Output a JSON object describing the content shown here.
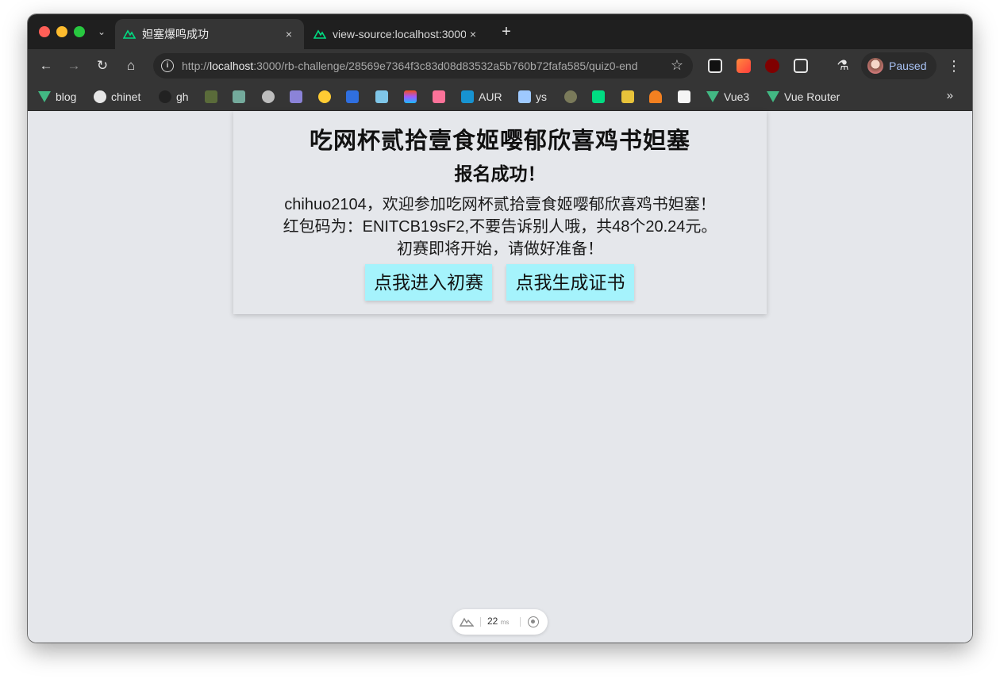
{
  "browser": {
    "tabs": [
      {
        "title": "妲塞爆鸣成功",
        "active": true
      },
      {
        "title": "view-source:localhost:3000",
        "active": false
      }
    ],
    "new_tab_label": "+",
    "close_label": "×",
    "url_scheme": "http://",
    "url_host": "localhost",
    "url_rest": ":3000/rb-challenge/28569e7364f3c83d08d83532a5b760b72fafa585/quiz0-end",
    "profile_status": "Paused",
    "bookmarks": [
      "blog",
      "chinet",
      "gh",
      "AUR",
      "ys",
      "Vue3",
      "Vue Router"
    ],
    "colors": {
      "nuxt_green": "#00dc82",
      "vue_green": "#42b883",
      "accent": "#a9c3f5"
    }
  },
  "page": {
    "title": "吃网杯贰拾壹食姬嘤郁欣喜鸡书妲塞",
    "subtitle": "报名成功！",
    "welcome": "chihuo2104，欢迎参加吃网杯贰拾壹食姬嘤郁欣喜鸡书妲塞！",
    "redpacket": "红包码为：ENITCB19sF2,不要告诉别人哦，共48个20.24元。",
    "prepare": "初赛即将开始，请做好准备！",
    "enter_button": "点我进入初赛",
    "cert_button": "点我生成证书",
    "button_color": "#a5f3fc"
  },
  "devtools": {
    "time_value": "22",
    "time_unit": "ms"
  }
}
